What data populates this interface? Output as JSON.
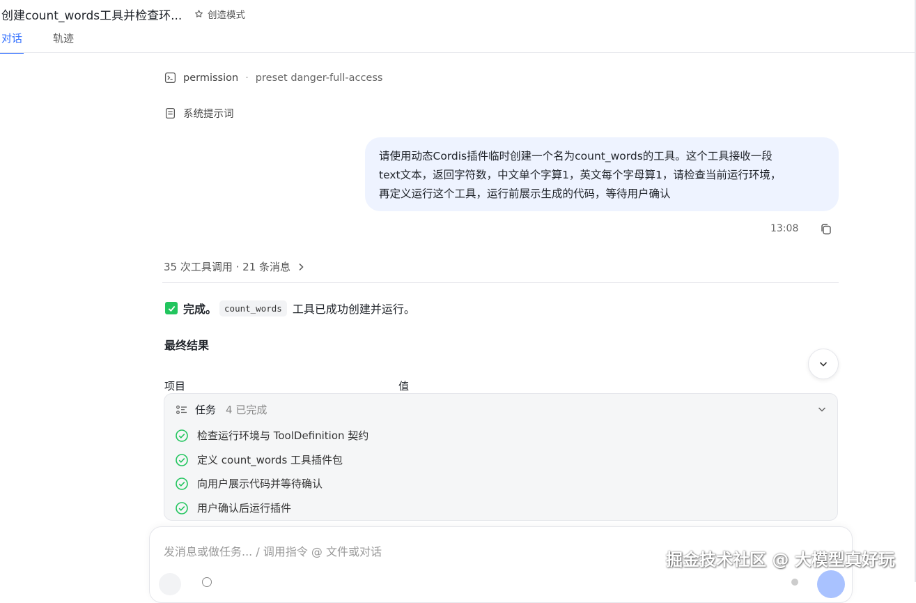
{
  "header": {
    "title": "创建count_words工具并检查环...",
    "mode_label": "创造模式",
    "tabs": [
      {
        "label": "对话",
        "active": true
      },
      {
        "label": "轨迹",
        "active": false
      }
    ]
  },
  "meta": {
    "permission_label": "permission",
    "permission_value": "preset danger-full-access",
    "system_prompt_label": "系统提示词"
  },
  "user_message": {
    "line1": "请使用动态Cordis插件临时创建一个名为count_words的工具。这个工具接收一段",
    "line2": "text文本，返回字符数，中文单个字算1，英文每个字母算1，请检查当前运行环境，",
    "line3": "再定义运行这个工具，运行前展示生成的代码，等待用户确认",
    "time": "13:08"
  },
  "summary": {
    "text": "35 次工具调用 · 21 条消息"
  },
  "result": {
    "done_label": "完成。",
    "code_name": "count_words",
    "done_text": "工具已成功创建并运行。",
    "final_heading": "最终结果",
    "col_item": "项目",
    "col_value": "值"
  },
  "tasks": {
    "label": "任务",
    "count": "4 已完成",
    "items": [
      {
        "label": "检查运行环境与 ToolDefinition 契约"
      },
      {
        "label": "定义 count_words 工具插件包"
      },
      {
        "label": "向用户展示代码并等待确认"
      },
      {
        "label": "用户确认后运行插件"
      }
    ]
  },
  "composer": {
    "placeholder": "发消息或做任务... / 调用指令 @ 文件或对话"
  },
  "watermark": "掘金技术社区 @ 大模型真好玩",
  "colors": {
    "accent": "#3370ff",
    "bubble_bg": "#eef3ff",
    "success": "#22c55e"
  }
}
